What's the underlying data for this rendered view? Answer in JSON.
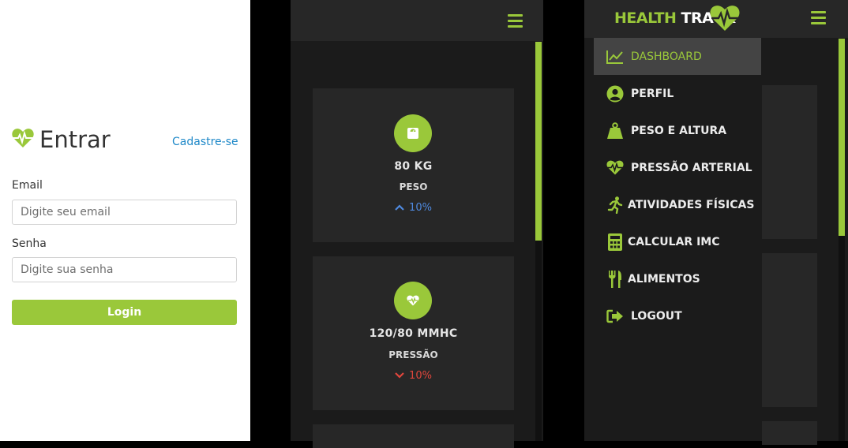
{
  "colors": {
    "accent": "#9ac83a",
    "up": "#4f8ae0",
    "down": "#e0463c",
    "link": "#1e88c8"
  },
  "login": {
    "title": "Entrar",
    "signup_link": "Cadastre-se",
    "email_label": "Email",
    "email_placeholder": "Digite seu email",
    "password_label": "Senha",
    "password_placeholder": "Digite sua senha",
    "login_button": "Login"
  },
  "dashboard": {
    "cards": [
      {
        "icon": "scale-icon",
        "value": "80 KG",
        "label": "PESO",
        "trend": "10%",
        "direction": "up"
      },
      {
        "icon": "heart-pulse-icon",
        "value": "120/80 MMHC",
        "label": "PRESSÃO",
        "trend": "10%",
        "direction": "down"
      }
    ]
  },
  "menu": {
    "logo_part1": "HEALTH",
    "logo_part2": "TRACK",
    "items": [
      {
        "label": "DASHBOARD",
        "icon": "chart-line-icon",
        "active": true
      },
      {
        "label": "PERFIL",
        "icon": "user-circle-icon"
      },
      {
        "label": "PESO E ALTURA",
        "icon": "weight-icon"
      },
      {
        "label": "PRESSÃO ARTERIAL",
        "icon": "heart-pulse-icon"
      },
      {
        "label": "ATIVIDADES FÍSICAS",
        "icon": "running-icon"
      },
      {
        "label": "CALCULAR IMC",
        "icon": "calculator-icon"
      },
      {
        "label": "ALIMENTOS",
        "icon": "utensils-icon"
      },
      {
        "label": "LOGOUT",
        "icon": "logout-icon"
      }
    ]
  }
}
